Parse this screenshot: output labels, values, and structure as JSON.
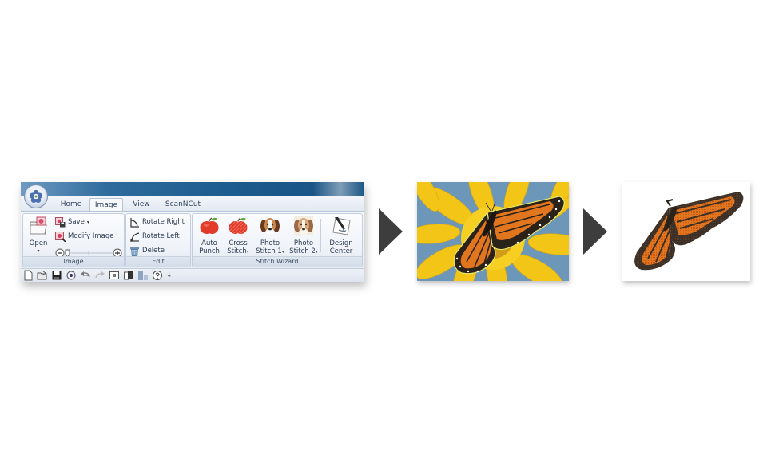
{
  "ribbon": {
    "tabs": [
      {
        "label": "Home",
        "active": false
      },
      {
        "label": "Image",
        "active": true
      },
      {
        "label": "View",
        "active": false
      },
      {
        "label": "ScanNCut",
        "active": false
      }
    ],
    "groups": {
      "image": {
        "label": "Image",
        "open_label": "Open",
        "save_label": "Save",
        "modify_label": "Modify Image"
      },
      "edit": {
        "label": "Edit",
        "rotate_right_label": "Rotate Right",
        "rotate_left_label": "Rotate Left",
        "delete_label": "Delete"
      },
      "stitch_wizard": {
        "label": "Stitch Wizard",
        "buttons": [
          {
            "line1": "Auto",
            "line2": "Punch"
          },
          {
            "line1": "Cross",
            "line2": "Stitch"
          },
          {
            "line1": "Photo",
            "line2": "Stitch 1"
          },
          {
            "line1": "Photo",
            "line2": "Stitch 2"
          }
        ]
      },
      "design_center": {
        "line1": "Design",
        "line2": "Center"
      }
    },
    "quick_access_icons": [
      "new-file-icon",
      "open-folder-icon",
      "save-icon",
      "zoom-icon",
      "undo-icon",
      "redo-icon",
      "frame-icon",
      "copy-icon",
      "layout-icon",
      "help-icon",
      "customize-icon"
    ],
    "caret_glyph": "▾",
    "customize_glyph": "⇣"
  },
  "colors": {
    "title_bar": "#1d5c8f",
    "arrow": "#3d3d3d",
    "apple_red": "#e23b2a",
    "butterfly_orange": "#e2761f",
    "butterfly_black": "#2b2219",
    "sunflower_yellow": "#f3c517",
    "sky_blue": "#6d97b8"
  }
}
